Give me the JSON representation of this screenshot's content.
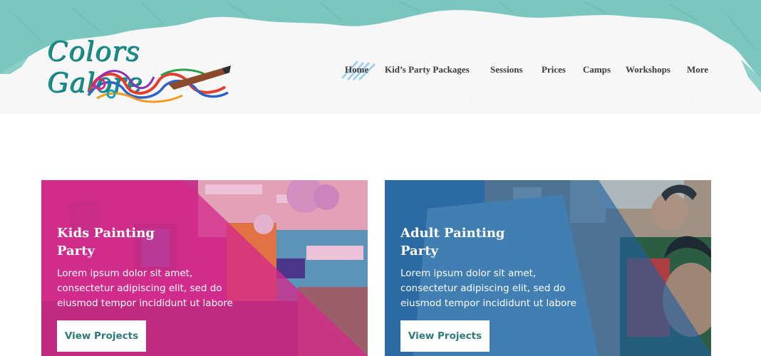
{
  "brand": {
    "logo_text": "Colors Galore"
  },
  "nav": {
    "items": [
      {
        "label": "Home",
        "active": true
      },
      {
        "label": "Kid’s Party Packages"
      },
      {
        "label": "Sessions"
      },
      {
        "label": "Prices"
      },
      {
        "label": "Camps"
      },
      {
        "label": "Workshops"
      },
      {
        "label": "More"
      }
    ]
  },
  "cards": [
    {
      "title_line1": "Kids Painting",
      "title_line2": "Party",
      "description": "Lorem ipsum dolor sit amet, consectetur adipiscing elit, sed do eiusmod tempor incididunt ut labore",
      "button_label": "View Projects",
      "overlay_color": "#d42a8a"
    },
    {
      "title_line1": "Adult Painting",
      "title_line2": "Party",
      "description": "Lorem ipsum dolor sit amet, consectetur adipiscing elit, sed do eiusmod tempor incididunt ut labore",
      "button_label": "View Projects",
      "overlay_color": "#2a70a8"
    }
  ],
  "colors": {
    "crayon_teal": "#6fc7bf",
    "brand_teal": "#1a8f8c",
    "button_text": "#2d7a78",
    "nav_text": "#3c3c3c"
  }
}
